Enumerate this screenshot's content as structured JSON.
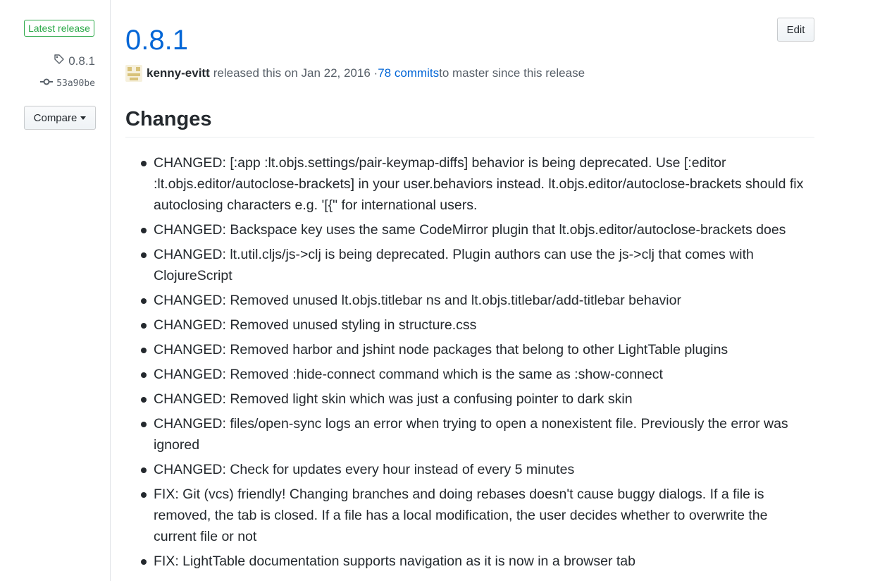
{
  "sidebar": {
    "latest_badge": "Latest release",
    "tag": "0.8.1",
    "commit": "53a90be",
    "compare_label": "Compare"
  },
  "release": {
    "title": "0.8.1",
    "edit_label": "Edit",
    "author": "kenny-evitt",
    "released_text": "released this on Jan 22, 2016 · ",
    "commits_link": "78 commits",
    "commits_suffix": " to master since this release"
  },
  "changes": {
    "heading": "Changes",
    "items": [
      "CHANGED: [:app :lt.objs.settings/pair-keymap-diffs] behavior is being deprecated. Use [:editor :lt.objs.editor/autoclose-brackets] in your user.behaviors instead. lt.objs.editor/autoclose-brackets should fix autoclosing characters e.g. '[{\" for international users.",
      "CHANGED: Backspace key uses the same CodeMirror plugin that lt.objs.editor/autoclose-brackets does",
      "CHANGED: lt.util.cljs/js->clj is being deprecated. Plugin authors can use the js->clj that comes with ClojureScript",
      "CHANGED: Removed unused lt.objs.titlebar ns and lt.objs.titlebar/add-titlebar behavior",
      "CHANGED: Removed unused styling in structure.css",
      "CHANGED: Removed harbor and jshint node packages that belong to other LightTable plugins",
      "CHANGED: Removed :hide-connect command which is the same as :show-connect",
      "CHANGED: Removed light skin which was just a confusing pointer to dark skin",
      "CHANGED: files/open-sync logs an error when trying to open a nonexistent file. Previously the error was ignored",
      "CHANGED: Check for updates every hour instead of every 5 minutes",
      "FIX: Git (vcs) friendly! Changing branches and doing rebases doesn't cause buggy dialogs. If a file is removed, the tab is closed. If a file has a local modification, the user decides whether to overwrite the current file or not",
      "FIX: LightTable documentation supports navigation as it is now in a browser tab"
    ]
  },
  "icons": {
    "tag": "tag-icon",
    "commit": "git-commit-icon",
    "caret": "caret-down-icon"
  },
  "colors": {
    "link": "#0366d6",
    "badge": "#28a745",
    "text": "#24292e",
    "muted": "#586069"
  }
}
